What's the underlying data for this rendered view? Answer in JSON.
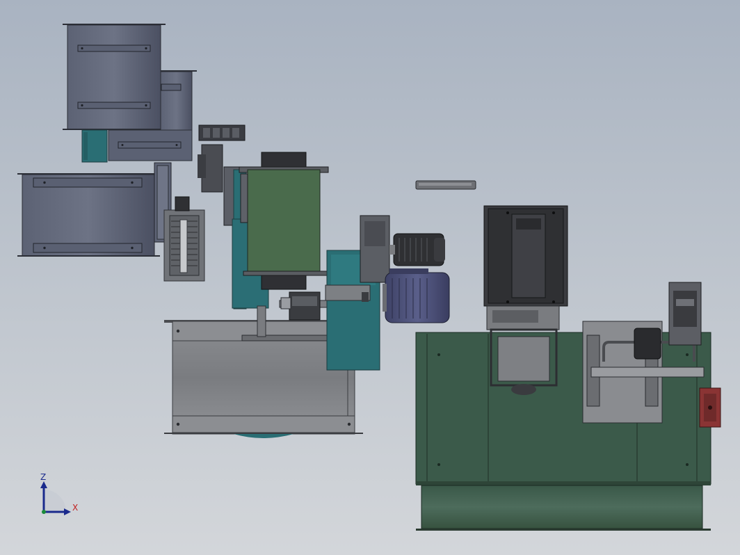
{
  "viewport": {
    "background_top": "#a9b3c1",
    "background_bottom": "#d3d6da"
  },
  "triad": {
    "z_label": "Z",
    "x_label": "X",
    "z_color": "#1a2a8c",
    "x_color": "#c02020",
    "y_color": "#1a8a3a"
  },
  "colors": {
    "duct_dark": "#4f5567",
    "duct_light": "#6a7082",
    "teal": "#2a6e74",
    "green_housing": "#4a6b4c",
    "dark_green_base": "#3b5a4a",
    "steel_gray": "#7d7f83",
    "motor_blue": "#464a72",
    "black_part": "#2f3033",
    "red_part": "#8a3434"
  }
}
